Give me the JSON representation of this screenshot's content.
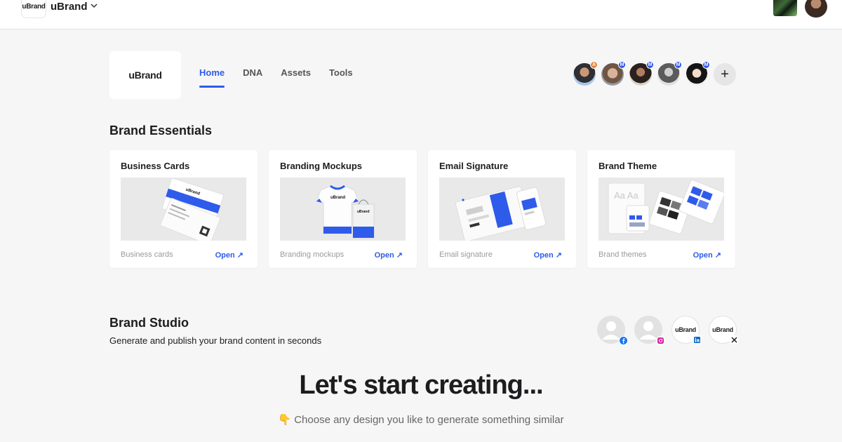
{
  "topbar": {
    "workspace_logo_text": "uBrand",
    "workspace_name": "uBrand",
    "icons": [
      "chevron-down-icon"
    ]
  },
  "brand": {
    "logo_text": "uBrand"
  },
  "nav": {
    "tabs": [
      {
        "label": "Home",
        "active": true
      },
      {
        "label": "DNA",
        "active": false
      },
      {
        "label": "Assets",
        "active": false
      },
      {
        "label": "Tools",
        "active": false
      }
    ]
  },
  "members": [
    {
      "role": "A",
      "role_color": "#e8833a"
    },
    {
      "role": "M",
      "role_color": "#2f5bea"
    },
    {
      "role": "M",
      "role_color": "#2f5bea"
    },
    {
      "role": "M",
      "role_color": "#2f5bea"
    },
    {
      "role": "M",
      "role_color": "#2f5bea"
    }
  ],
  "add_member_label": "+",
  "essentials": {
    "title": "Brand Essentials",
    "cards": [
      {
        "title": "Business Cards",
        "desc": "Business cards",
        "open": "Open ↗"
      },
      {
        "title": "Branding Mockups",
        "desc": "Branding mockups",
        "open": "Open ↗"
      },
      {
        "title": "Email Signature",
        "desc": "Email signature",
        "open": "Open ↗"
      },
      {
        "title": "Brand Theme",
        "desc": "Brand themes",
        "open": "Open ↗"
      }
    ]
  },
  "studio": {
    "title": "Brand Studio",
    "subtitle": "Generate and publish your brand content in seconds",
    "socials": [
      {
        "network": "facebook",
        "logo_text": ""
      },
      {
        "network": "instagram",
        "logo_text": ""
      },
      {
        "network": "linkedin",
        "logo_text": "uBrand"
      },
      {
        "network": "x",
        "logo_text": "uBrand"
      }
    ]
  },
  "hero": {
    "headline": "Let's start creating...",
    "subline": "👇 Choose any design you like to generate something similar"
  },
  "colors": {
    "accent": "#2f5bea",
    "background": "#f6f6f6",
    "admin_badge": "#e8833a"
  }
}
